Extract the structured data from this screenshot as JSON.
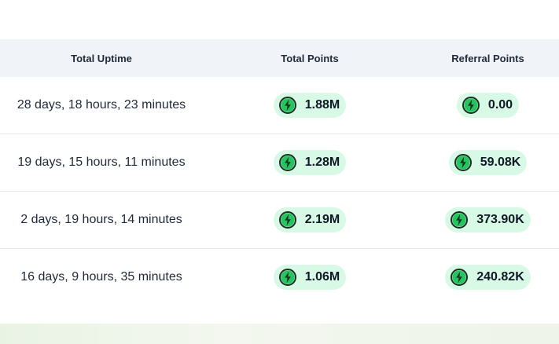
{
  "headers": {
    "uptime": "Total Uptime",
    "points": "Total Points",
    "referral": "Referral Points"
  },
  "rows": [
    {
      "uptime": "28 days, 18 hours, 23 minutes",
      "points": "1.88M",
      "referral": "0.00"
    },
    {
      "uptime": "19 days, 15 hours, 11 minutes",
      "points": "1.28M",
      "referral": "59.08K"
    },
    {
      "uptime": "2 days, 19 hours, 14 minutes",
      "points": "2.19M",
      "referral": "373.90K"
    },
    {
      "uptime": "16 days, 9 hours, 35 minutes",
      "points": "1.06M",
      "referral": "240.82K"
    }
  ],
  "icons": {
    "points": "lightning-bolt-icon"
  },
  "colors": {
    "pill_bg": "#d7f9e5",
    "icon_green": "#10b981",
    "header_bg": "#f0f3f7"
  }
}
